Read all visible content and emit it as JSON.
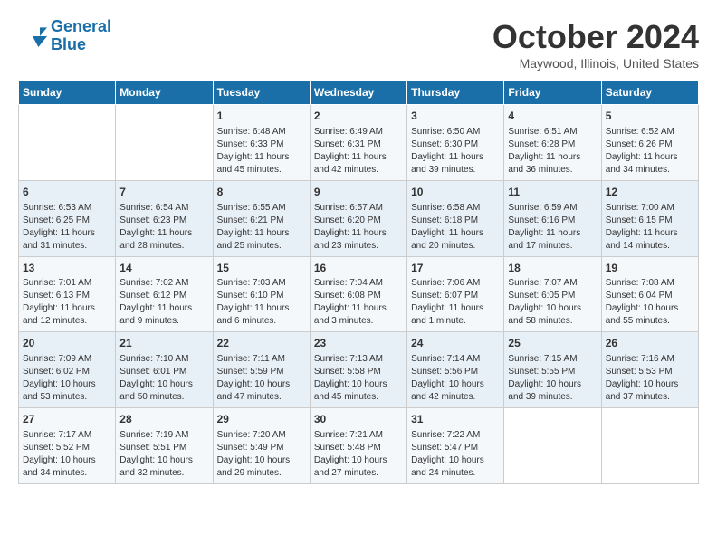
{
  "header": {
    "logo": {
      "line1": "General",
      "line2": "Blue"
    },
    "title": "October 2024",
    "subtitle": "Maywood, Illinois, United States"
  },
  "days_of_week": [
    "Sunday",
    "Monday",
    "Tuesday",
    "Wednesday",
    "Thursday",
    "Friday",
    "Saturday"
  ],
  "weeks": [
    [
      {
        "day": "",
        "info": ""
      },
      {
        "day": "",
        "info": ""
      },
      {
        "day": "1",
        "info": "Sunrise: 6:48 AM\nSunset: 6:33 PM\nDaylight: 11 hours and 45 minutes."
      },
      {
        "day": "2",
        "info": "Sunrise: 6:49 AM\nSunset: 6:31 PM\nDaylight: 11 hours and 42 minutes."
      },
      {
        "day": "3",
        "info": "Sunrise: 6:50 AM\nSunset: 6:30 PM\nDaylight: 11 hours and 39 minutes."
      },
      {
        "day": "4",
        "info": "Sunrise: 6:51 AM\nSunset: 6:28 PM\nDaylight: 11 hours and 36 minutes."
      },
      {
        "day": "5",
        "info": "Sunrise: 6:52 AM\nSunset: 6:26 PM\nDaylight: 11 hours and 34 minutes."
      }
    ],
    [
      {
        "day": "6",
        "info": "Sunrise: 6:53 AM\nSunset: 6:25 PM\nDaylight: 11 hours and 31 minutes."
      },
      {
        "day": "7",
        "info": "Sunrise: 6:54 AM\nSunset: 6:23 PM\nDaylight: 11 hours and 28 minutes."
      },
      {
        "day": "8",
        "info": "Sunrise: 6:55 AM\nSunset: 6:21 PM\nDaylight: 11 hours and 25 minutes."
      },
      {
        "day": "9",
        "info": "Sunrise: 6:57 AM\nSunset: 6:20 PM\nDaylight: 11 hours and 23 minutes."
      },
      {
        "day": "10",
        "info": "Sunrise: 6:58 AM\nSunset: 6:18 PM\nDaylight: 11 hours and 20 minutes."
      },
      {
        "day": "11",
        "info": "Sunrise: 6:59 AM\nSunset: 6:16 PM\nDaylight: 11 hours and 17 minutes."
      },
      {
        "day": "12",
        "info": "Sunrise: 7:00 AM\nSunset: 6:15 PM\nDaylight: 11 hours and 14 minutes."
      }
    ],
    [
      {
        "day": "13",
        "info": "Sunrise: 7:01 AM\nSunset: 6:13 PM\nDaylight: 11 hours and 12 minutes."
      },
      {
        "day": "14",
        "info": "Sunrise: 7:02 AM\nSunset: 6:12 PM\nDaylight: 11 hours and 9 minutes."
      },
      {
        "day": "15",
        "info": "Sunrise: 7:03 AM\nSunset: 6:10 PM\nDaylight: 11 hours and 6 minutes."
      },
      {
        "day": "16",
        "info": "Sunrise: 7:04 AM\nSunset: 6:08 PM\nDaylight: 11 hours and 3 minutes."
      },
      {
        "day": "17",
        "info": "Sunrise: 7:06 AM\nSunset: 6:07 PM\nDaylight: 11 hours and 1 minute."
      },
      {
        "day": "18",
        "info": "Sunrise: 7:07 AM\nSunset: 6:05 PM\nDaylight: 10 hours and 58 minutes."
      },
      {
        "day": "19",
        "info": "Sunrise: 7:08 AM\nSunset: 6:04 PM\nDaylight: 10 hours and 55 minutes."
      }
    ],
    [
      {
        "day": "20",
        "info": "Sunrise: 7:09 AM\nSunset: 6:02 PM\nDaylight: 10 hours and 53 minutes."
      },
      {
        "day": "21",
        "info": "Sunrise: 7:10 AM\nSunset: 6:01 PM\nDaylight: 10 hours and 50 minutes."
      },
      {
        "day": "22",
        "info": "Sunrise: 7:11 AM\nSunset: 5:59 PM\nDaylight: 10 hours and 47 minutes."
      },
      {
        "day": "23",
        "info": "Sunrise: 7:13 AM\nSunset: 5:58 PM\nDaylight: 10 hours and 45 minutes."
      },
      {
        "day": "24",
        "info": "Sunrise: 7:14 AM\nSunset: 5:56 PM\nDaylight: 10 hours and 42 minutes."
      },
      {
        "day": "25",
        "info": "Sunrise: 7:15 AM\nSunset: 5:55 PM\nDaylight: 10 hours and 39 minutes."
      },
      {
        "day": "26",
        "info": "Sunrise: 7:16 AM\nSunset: 5:53 PM\nDaylight: 10 hours and 37 minutes."
      }
    ],
    [
      {
        "day": "27",
        "info": "Sunrise: 7:17 AM\nSunset: 5:52 PM\nDaylight: 10 hours and 34 minutes."
      },
      {
        "day": "28",
        "info": "Sunrise: 7:19 AM\nSunset: 5:51 PM\nDaylight: 10 hours and 32 minutes."
      },
      {
        "day": "29",
        "info": "Sunrise: 7:20 AM\nSunset: 5:49 PM\nDaylight: 10 hours and 29 minutes."
      },
      {
        "day": "30",
        "info": "Sunrise: 7:21 AM\nSunset: 5:48 PM\nDaylight: 10 hours and 27 minutes."
      },
      {
        "day": "31",
        "info": "Sunrise: 7:22 AM\nSunset: 5:47 PM\nDaylight: 10 hours and 24 minutes."
      },
      {
        "day": "",
        "info": ""
      },
      {
        "day": "",
        "info": ""
      }
    ]
  ]
}
